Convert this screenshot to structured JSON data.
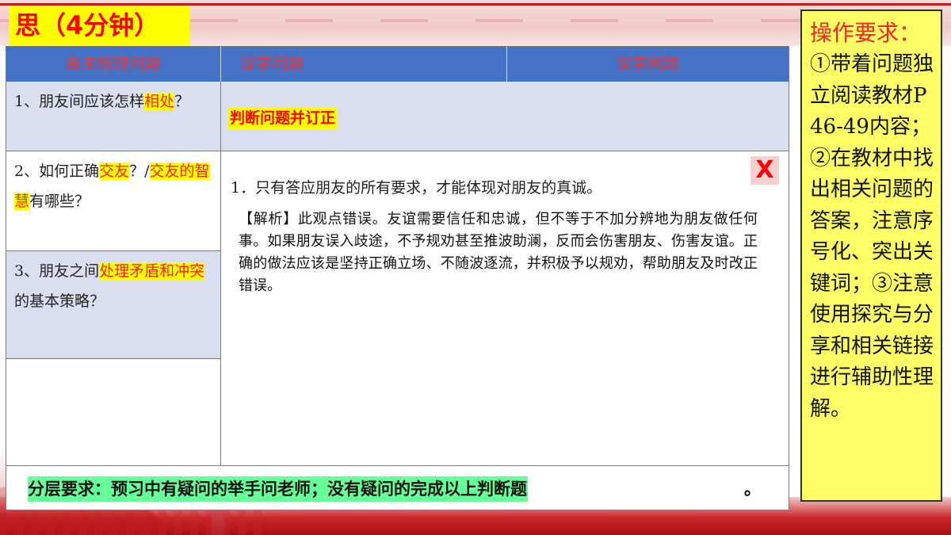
{
  "title": "思（4分钟）",
  "table": {
    "headers": [
      "自主梳理问题",
      "议学问题",
      "议学问题"
    ],
    "left_rows": [
      {
        "parts": [
          {
            "t": "1、朋友间应该怎样"
          },
          {
            "t": "相处",
            "hl": true
          },
          {
            "t": "？"
          }
        ]
      },
      {
        "parts": [
          {
            "t": "2、如何正确"
          },
          {
            "t": "交友",
            "hl": true
          },
          {
            "t": "？/"
          },
          {
            "t": "交友的智慧",
            "hl": true
          },
          {
            "t": "有哪些？"
          }
        ]
      },
      {
        "parts": [
          {
            "t": "3、朋友之间"
          },
          {
            "t": "处理矛盾和冲突",
            "hl": true
          },
          {
            "t": "的基本策略？"
          }
        ]
      },
      {
        "parts": []
      }
    ],
    "judge_label": "判断问题并订正",
    "wrong_mark": "X",
    "statement": "1．只有答应朋友的所有要求，才能体现对朋友的真诚。",
    "analysis": "【解析】此观点错误。友谊需要信任和忠诚，但不等于不加分辨地为朋友做任何事。如果朋友误入歧途，不予规劝甚至推波助澜，反而会伤害朋友、伤害友谊。正确的做法应该是坚持正确立场、不随波逐流，并积极予以规劝，帮助朋友及时改正错误。"
  },
  "layered_requirement": {
    "text": "分层要求：预习中有疑问的举手问老师；没有疑问的完成以上判断题",
    "end": "。"
  },
  "side_panel": {
    "title": "操作要求：",
    "body": "①带着问题独立阅读教材P46-49内容；②在教材中找出相关问题的答案，注意序号化、突出关键词；③注意使用探究与分享和相关链接进行辅助性理解。"
  },
  "colors": {
    "accent_red": "#ff0000",
    "highlight_yellow": "#ffff00",
    "header_blue": "#4472c4",
    "row_blue": "#d9dfee",
    "green_highlight": "#66ff99",
    "panel_yellow": "#ffff66"
  }
}
